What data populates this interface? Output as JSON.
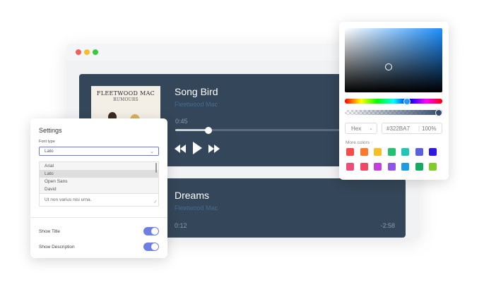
{
  "browser": {
    "window_dots": [
      "red",
      "yellow",
      "green"
    ]
  },
  "player": {
    "track1": {
      "title": "Song Bird",
      "artist": "Fleetwood Mac",
      "current_time": "0:45",
      "progress": 0.19,
      "album_title": "FLEETWOOD MAC",
      "album_subtitle": "RUMOURS"
    },
    "track2": {
      "title": "Dreams",
      "artist": "Fleetwood Mac",
      "current_time": "0:12",
      "remaining_time": "-2:58"
    }
  },
  "settings": {
    "title": "Settings",
    "font_type_label": "Font type",
    "font_select_value": "Lato",
    "font_options": [
      "Arial",
      "Lato",
      "Open Sans",
      "David"
    ],
    "selected_font": "Lato",
    "textarea_value": "Ut non varius nisi urna.",
    "show_title_label": "Show Title",
    "show_title_on": true,
    "show_description_label": "Show Description",
    "show_description_on": true
  },
  "color_picker": {
    "format": "Hex",
    "hex_value": "#322BA7",
    "alpha": "100%",
    "more_colors_label": "More colors",
    "swatches_row1": [
      "#f44b4b",
      "#f97a2d",
      "#f6bf26",
      "#22c06f",
      "#1fc7b7",
      "#5a5fe0",
      "#2f17e8"
    ],
    "swatches_row2": [
      "#ee4c7b",
      "#f24662",
      "#c43fe0",
      "#8e55e8",
      "#1e9be6",
      "#13aa62",
      "#80cc2a"
    ]
  }
}
